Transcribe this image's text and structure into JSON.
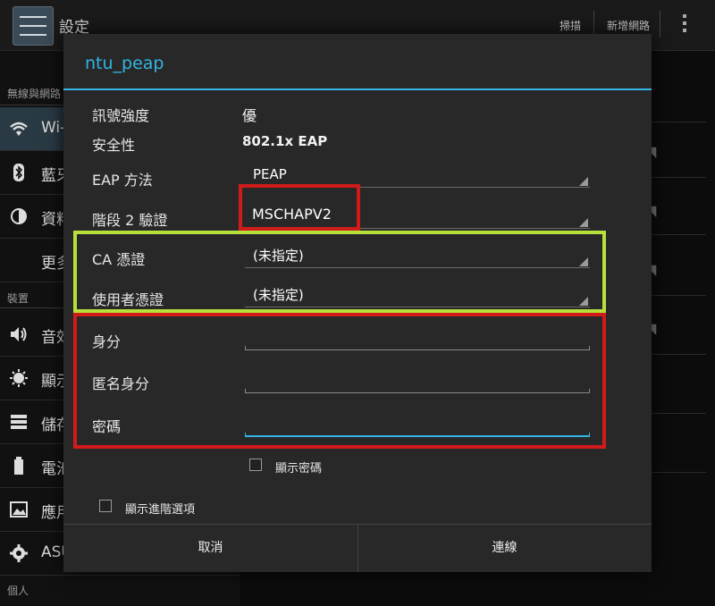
{
  "app": {
    "title": "設定",
    "actions": {
      "scan": "掃描",
      "add_network": "新增網路"
    }
  },
  "sidebar": {
    "sections": [
      {
        "header": "無線與網路"
      },
      {
        "header": "裝置"
      },
      {
        "header": "個人"
      }
    ],
    "items": [
      {
        "label": "Wi-",
        "icon": "wifi-icon"
      },
      {
        "label": "藍牙",
        "icon": "bluetooth-icon"
      },
      {
        "label": "資料",
        "icon": "data-usage-icon"
      },
      {
        "label": "更多",
        "icon": ""
      },
      {
        "label": "音效",
        "icon": "sound-icon"
      },
      {
        "label": "顯示",
        "icon": "display-icon"
      },
      {
        "label": "儲存",
        "icon": "storage-icon"
      },
      {
        "label": "電池",
        "icon": "battery-icon"
      },
      {
        "label": "應用",
        "icon": "apps-icon"
      },
      {
        "label": "ASU",
        "icon": "asus-icon"
      }
    ]
  },
  "dialog": {
    "title": "ntu_peap",
    "signal_label": "訊號強度",
    "signal_value": "優",
    "security_label": "安全性",
    "security_value": "802.1x EAP",
    "eap_label": "EAP 方法",
    "eap_value": "PEAP",
    "phase2_label": "階段 2 驗證",
    "phase2_value": "MSCHAPV2",
    "ca_label": "CA 憑證",
    "ca_value": "(未指定)",
    "user_cert_label": "使用者憑證",
    "user_cert_value": "(未指定)",
    "identity_label": "身分",
    "identity_value": "",
    "anon_label": "匿名身分",
    "anon_value": "",
    "password_label": "密碼",
    "password_value": "",
    "show_password_label": "顯示密碼",
    "show_password_checked": false,
    "advanced_label": "顯示進階選項",
    "advanced_checked": false,
    "cancel_label": "取消",
    "connect_label": "連線"
  },
  "colors": {
    "accent": "#33b5e5",
    "highlight_red": "#d11a1a",
    "highlight_green": "#b7e03a"
  }
}
